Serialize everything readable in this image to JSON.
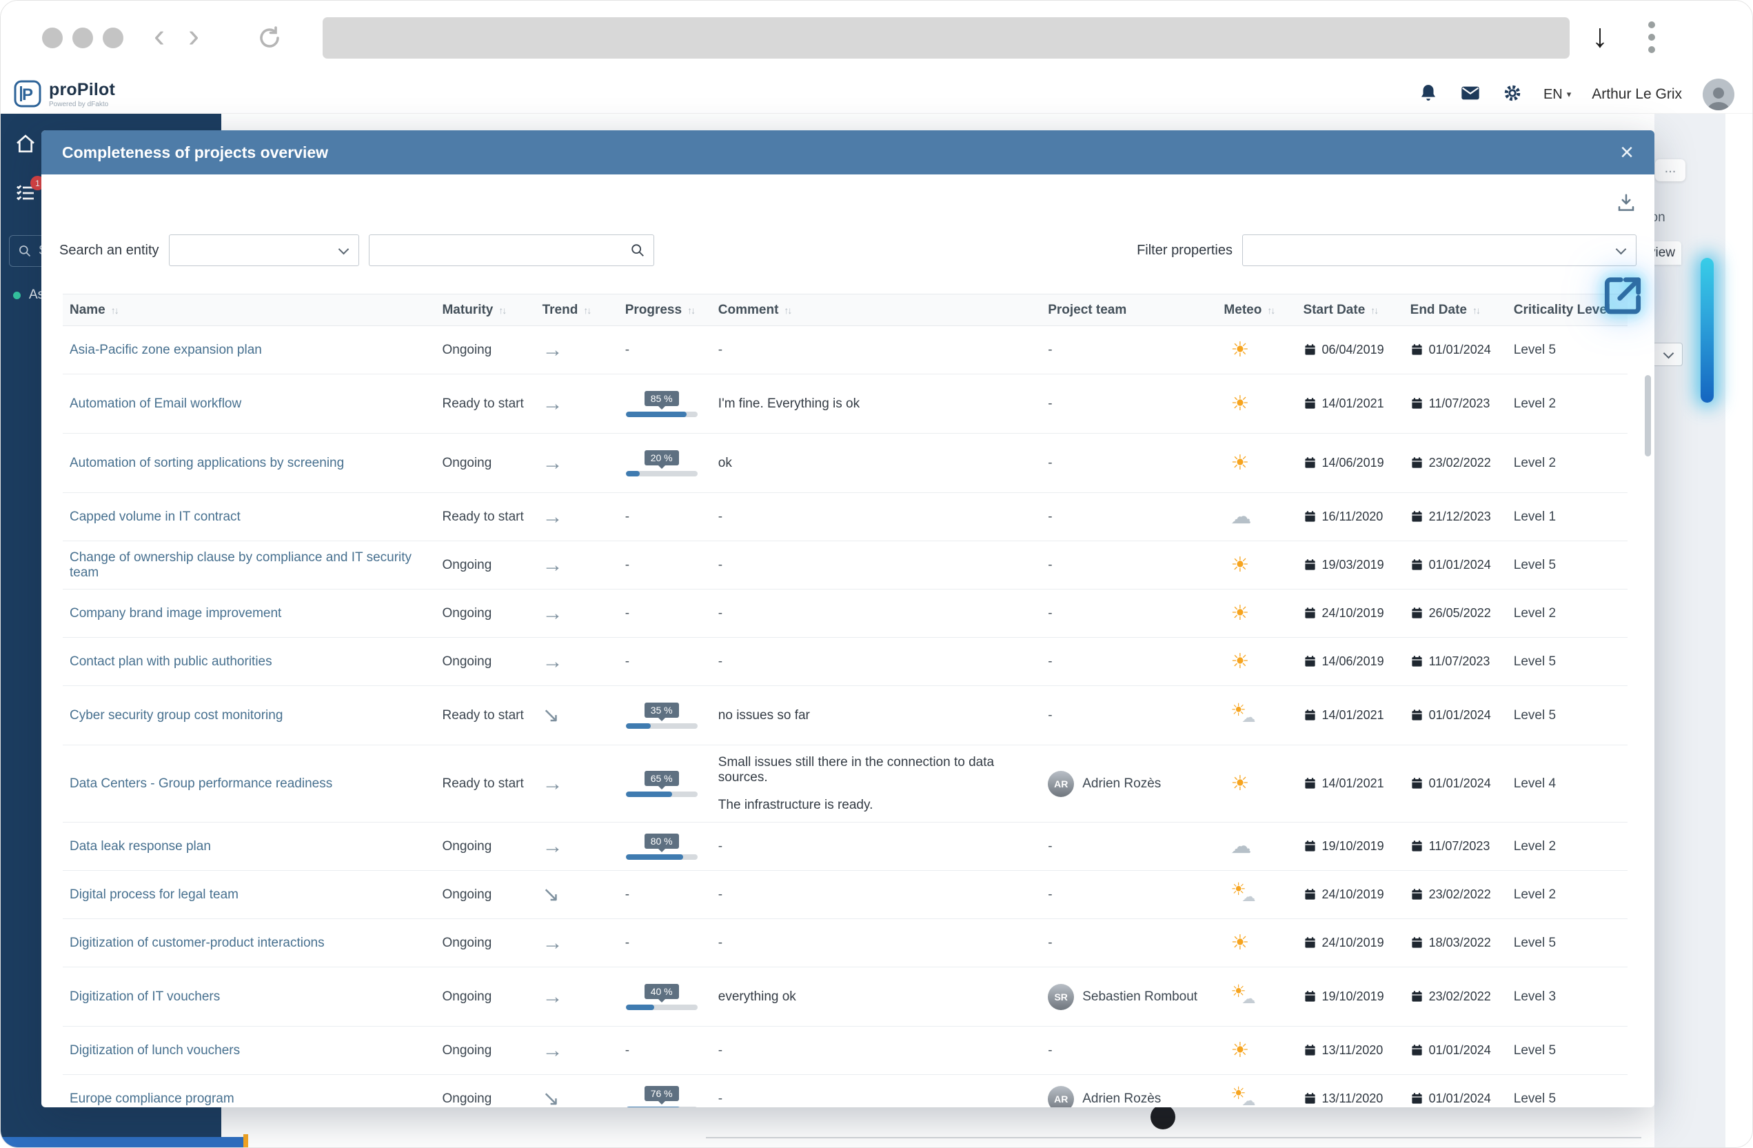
{
  "browser": {
    "url": ""
  },
  "app_header": {
    "logo_title": "proPilot",
    "logo_subtitle": "Powered by dFakto",
    "language": "EN",
    "user_name": "Arthur Le Grix"
  },
  "sidebar": {
    "search_text": "Se",
    "item_label": "As",
    "badge_count": "1"
  },
  "background_page": {
    "ellipsis": "...",
    "fragment_tion": "tion",
    "fragment_view": "view"
  },
  "colors": {
    "modal_header": "#4e7ca8",
    "sidebar": "#1c3d60",
    "link": "#47708f",
    "progress_fill": "#3f7bb0",
    "sun": "#f6a41f",
    "highlight_glow": "#35d3f0"
  },
  "modal": {
    "title": "Completeness of projects overview",
    "close_label": "×",
    "search_entity_label": "Search an entity",
    "search_value": "",
    "filter_label": "Filter properties",
    "table": {
      "columns": [
        {
          "label": "Name",
          "sortable": true
        },
        {
          "label": "Maturity",
          "sortable": true
        },
        {
          "label": "Trend",
          "sortable": true
        },
        {
          "label": "Progress",
          "sortable": true
        },
        {
          "label": "Comment",
          "sortable": true
        },
        {
          "label": "Project team",
          "sortable": false
        },
        {
          "label": "Meteo",
          "sortable": true
        },
        {
          "label": "Start Date",
          "sortable": true
        },
        {
          "label": "End Date",
          "sortable": true
        },
        {
          "label": "Criticality Level",
          "sortable": false
        }
      ],
      "rows": [
        {
          "name": "Asia-Pacific zone expansion plan",
          "maturity": "Ongoing",
          "trend": "right",
          "progress": null,
          "comment": "-",
          "team": null,
          "meteo": "sunny",
          "start_date": "06/04/2019",
          "end_date": "01/01/2024",
          "criticality": "Level 5"
        },
        {
          "name": "Automation of Email workflow",
          "maturity": "Ready to start",
          "trend": "right",
          "progress": 85,
          "comment": "I'm fine. Everything is ok",
          "team": null,
          "meteo": "sunny",
          "start_date": "14/01/2021",
          "end_date": "11/07/2023",
          "criticality": "Level 2"
        },
        {
          "name": "Automation of sorting applications by screening",
          "maturity": "Ongoing",
          "trend": "right",
          "progress": 20,
          "comment": "ok",
          "team": null,
          "meteo": "sunny",
          "start_date": "14/06/2019",
          "end_date": "23/02/2022",
          "criticality": "Level 2"
        },
        {
          "name": "Capped volume in IT contract",
          "maturity": "Ready to start",
          "trend": "right",
          "progress": null,
          "comment": "-",
          "team": null,
          "meteo": "cloudy",
          "start_date": "16/11/2020",
          "end_date": "21/12/2023",
          "criticality": "Level 1"
        },
        {
          "name": "Change of ownership clause by compliance and IT security team",
          "maturity": "Ongoing",
          "trend": "right",
          "progress": null,
          "comment": "-",
          "team": null,
          "meteo": "sunny",
          "start_date": "19/03/2019",
          "end_date": "01/01/2024",
          "criticality": "Level 5"
        },
        {
          "name": "Company brand image improvement",
          "maturity": "Ongoing",
          "trend": "right",
          "progress": null,
          "comment": "-",
          "team": null,
          "meteo": "sunny",
          "start_date": "24/10/2019",
          "end_date": "26/05/2022",
          "criticality": "Level 2"
        },
        {
          "name": "Contact plan with public authorities",
          "maturity": "Ongoing",
          "trend": "right",
          "progress": null,
          "comment": "-",
          "team": null,
          "meteo": "sunny",
          "start_date": "14/06/2019",
          "end_date": "11/07/2023",
          "criticality": "Level 5"
        },
        {
          "name": "Cyber security group cost monitoring",
          "maturity": "Ready to start",
          "trend": "down",
          "progress": 35,
          "comment": "no issues so far",
          "team": null,
          "meteo": "partly",
          "start_date": "14/01/2021",
          "end_date": "01/01/2024",
          "criticality": "Level 5"
        },
        {
          "name": "Data Centers - Group performance readiness",
          "maturity": "Ready to start",
          "trend": "right",
          "progress": 65,
          "comment": [
            "Small issues still there in the connection to data sources.",
            "The infrastructure is ready."
          ],
          "team": "Adrien Rozès",
          "meteo": "sunny",
          "start_date": "14/01/2021",
          "end_date": "01/01/2024",
          "criticality": "Level 4"
        },
        {
          "name": "Data leak response plan",
          "maturity": "Ongoing",
          "trend": "right",
          "progress": 80,
          "comment": "-",
          "team": null,
          "meteo": "cloudy",
          "start_date": "19/10/2019",
          "end_date": "11/07/2023",
          "criticality": "Level 2"
        },
        {
          "name": "Digital process for legal team",
          "maturity": "Ongoing",
          "trend": "down",
          "progress": null,
          "comment": "-",
          "team": null,
          "meteo": "partly",
          "start_date": "24/10/2019",
          "end_date": "23/02/2022",
          "criticality": "Level 2"
        },
        {
          "name": "Digitization of customer-product interactions",
          "maturity": "Ongoing",
          "trend": "right",
          "progress": null,
          "comment": "-",
          "team": null,
          "meteo": "sunny",
          "start_date": "24/10/2019",
          "end_date": "18/03/2022",
          "criticality": "Level 5"
        },
        {
          "name": "Digitization of IT vouchers",
          "maturity": "Ongoing",
          "trend": "right",
          "progress": 40,
          "comment": "everything ok",
          "team": "Sebastien Rombout",
          "meteo": "partly",
          "start_date": "19/10/2019",
          "end_date": "23/02/2022",
          "criticality": "Level 3"
        },
        {
          "name": "Digitization of lunch vouchers",
          "maturity": "Ongoing",
          "trend": "right",
          "progress": null,
          "comment": "-",
          "team": null,
          "meteo": "sunny",
          "start_date": "13/11/2020",
          "end_date": "01/01/2024",
          "criticality": "Level 5"
        },
        {
          "name": "Europe compliance program",
          "maturity": "Ongoing",
          "trend": "down",
          "progress": 76,
          "comment": "-",
          "team": "Adrien Rozès",
          "meteo": "partly",
          "start_date": "13/11/2020",
          "end_date": "01/01/2024",
          "criticality": "Level 5"
        }
      ]
    }
  }
}
